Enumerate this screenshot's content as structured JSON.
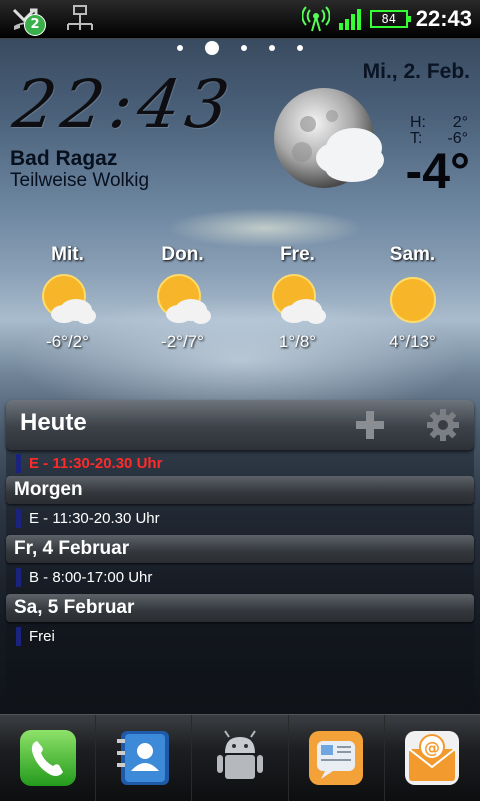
{
  "status_bar": {
    "notification_count": "2",
    "battery": "84",
    "time": "22:43",
    "icons": [
      "missed-call-icon",
      "usb-debug-icon",
      "wifi-hotspot-icon",
      "signal-icon",
      "battery-icon"
    ]
  },
  "home_pages": {
    "count": 5,
    "active_index": 1
  },
  "clock": {
    "time": "22:43"
  },
  "weather": {
    "date": "Mi., 2. Feb.",
    "city": "Bad Ragaz",
    "condition": "Teilweise Wolkig",
    "high_label": "H:",
    "high": "2°",
    "low_label": "T:",
    "low": "-6°",
    "current": "-4°",
    "icon": "moon-cloud-icon",
    "forecast": [
      {
        "day": "Mit.",
        "temps": "-6°/2°",
        "icon": "sun-cloud-icon"
      },
      {
        "day": "Don.",
        "temps": "-2°/7°",
        "icon": "sun-cloud-icon"
      },
      {
        "day": "Fre.",
        "temps": "1°/8°",
        "icon": "sun-cloud-icon"
      },
      {
        "day": "Sam.",
        "temps": "4°/13°",
        "icon": "sun-icon"
      }
    ]
  },
  "agenda": {
    "title": "Heute",
    "today_event": "E - 11:30-20.30 Uhr",
    "sections": [
      {
        "label": "Morgen",
        "event": "E - 11:30-20.30 Uhr"
      },
      {
        "label": "Fr, 4 Februar",
        "event": "B - 8:00-17:00 Uhr"
      },
      {
        "label": "Sa, 5 Februar",
        "event": "Frei"
      }
    ],
    "accent_color": "#1a237e",
    "today_color": "#ff2a2a"
  },
  "dock": [
    "phone-icon",
    "contacts-icon",
    "app-drawer-icon",
    "messaging-icon",
    "email-icon"
  ]
}
